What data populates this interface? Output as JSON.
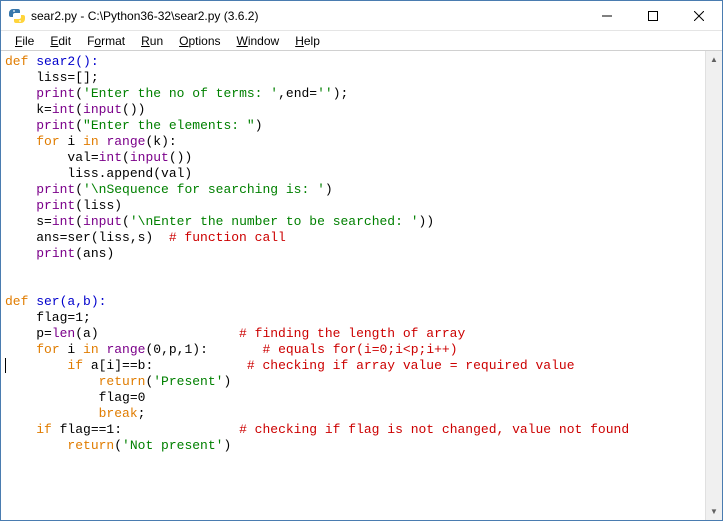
{
  "window": {
    "title": "sear2.py - C:\\Python36-32\\sear2.py (3.6.2)"
  },
  "menus": {
    "file": "File",
    "edit": "Edit",
    "format": "Format",
    "run": "Run",
    "options": "Options",
    "window": "Window",
    "help": "Help"
  },
  "code": {
    "l01a": "def",
    "l01b": " sear2():",
    "l02a": "    liss=[];",
    "l03a": "    ",
    "l03b": "print",
    "l03c": "(",
    "l03d": "'Enter the no of terms: '",
    "l03e": ",end=",
    "l03f": "''",
    "l03g": ");",
    "l04a": "    k=",
    "l04b": "int",
    "l04c": "(",
    "l04d": "input",
    "l04e": "())",
    "l05a": "    ",
    "l05b": "print",
    "l05c": "(",
    "l05d": "\"Enter the elements: \"",
    "l05e": ")",
    "l06a": "    ",
    "l06b": "for",
    "l06c": " i ",
    "l06d": "in",
    "l06e": " ",
    "l06f": "range",
    "l06g": "(k):",
    "l07a": "        val=",
    "l07b": "int",
    "l07c": "(",
    "l07d": "input",
    "l07e": "())",
    "l08a": "        liss.append(val)",
    "l09a": "    ",
    "l09b": "print",
    "l09c": "(",
    "l09d": "'\\nSequence for searching is: '",
    "l09e": ")",
    "l10a": "    ",
    "l10b": "print",
    "l10c": "(liss)",
    "l11a": "    s=",
    "l11b": "int",
    "l11c": "(",
    "l11d": "input",
    "l11e": "(",
    "l11f": "'\\nEnter the number to be searched: '",
    "l11g": "))",
    "l12a": "    ans=ser(liss,s)  ",
    "l12b": "# function call",
    "l13a": "    ",
    "l13b": "print",
    "l13c": "(ans)",
    "l16a": "def",
    "l16b": " ser(a,b):",
    "l17a": "    flag=1;",
    "l18a": "    p=",
    "l18b": "len",
    "l18c": "(a)                  ",
    "l18d": "# finding the length of array",
    "l19a": "    ",
    "l19b": "for",
    "l19c": " i ",
    "l19d": "in",
    "l19e": " ",
    "l19f": "range",
    "l19g": "(0,p,1):       ",
    "l19h": "# equals for(i=0;i<p;i++)",
    "l20a": "        ",
    "l20b": "if",
    "l20c": " a[i]==b:            ",
    "l20d": "# checking if array value = required value",
    "l21a": "            ",
    "l21b": "return",
    "l21c": "(",
    "l21d": "'Present'",
    "l21e": ")",
    "l22a": "            flag=0",
    "l23a": "            ",
    "l23b": "break",
    "l23c": ";",
    "l24a": "    ",
    "l24b": "if",
    "l24c": " flag==1:               ",
    "l24d": "# checking if flag is not changed, value not found",
    "l25a": "        ",
    "l25b": "return",
    "l25c": "(",
    "l25d": "'Not present'",
    "l25e": ")"
  }
}
